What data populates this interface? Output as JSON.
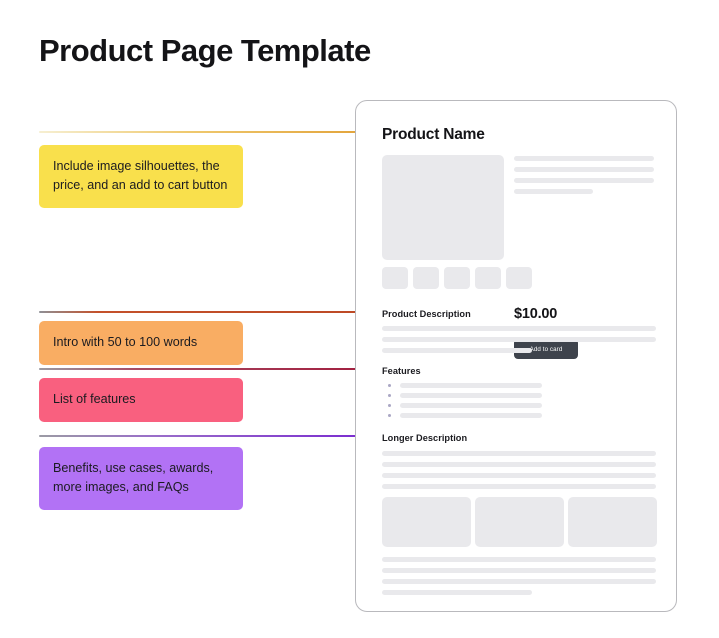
{
  "page": {
    "title": "Product Page Template",
    "background_color": "#ffffff"
  },
  "notes": [
    {
      "id": "note-images-price-cart",
      "text": "Include image silhouettes, the price, and an add to cart button",
      "color": "#f9e04c",
      "connector_color": "#e2a33a",
      "dot_color": "#e2a33a"
    },
    {
      "id": "note-intro",
      "text": "Intro with 50 to 100 words",
      "color": "#f9ad63",
      "connector_color": "#c4512a",
      "dot_color": "#bd4a25"
    },
    {
      "id": "note-features",
      "text": "List of features",
      "color": "#f9607f",
      "connector_color": "#a21f3f",
      "dot_color": "#a21f3f"
    },
    {
      "id": "note-benefits",
      "text": "Benefits, use cases, awards, more images, and FAQs",
      "color": "#b272f5",
      "connector_color": "#7a2bd0",
      "dot_color": "#7a2bd0"
    }
  ],
  "card": {
    "product_name": "Product Name",
    "price": "$10.00",
    "add_to_cart_label": "Add to card",
    "add_to_cart_color": "#3e434c",
    "sections": [
      {
        "id": "product-description",
        "heading": "Product Description"
      },
      {
        "id": "features",
        "heading": "Features"
      },
      {
        "id": "longer-description",
        "heading": "Longer Description"
      }
    ],
    "placeholder_color": "#e9e9ec",
    "bullet_color": "#aaa7c4",
    "thumbnail_count": 5,
    "feature_bullet_count": 4,
    "gallery_image_count": 3
  }
}
